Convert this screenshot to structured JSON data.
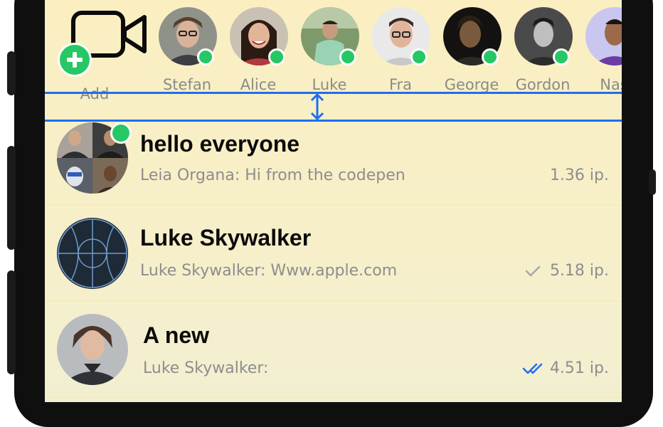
{
  "stories": {
    "add_label": "Add",
    "people": [
      {
        "name": "Stefan"
      },
      {
        "name": "Alice"
      },
      {
        "name": "Luke"
      },
      {
        "name": "Fra"
      },
      {
        "name": "George"
      },
      {
        "name": "Gordon"
      },
      {
        "name": "Nas"
      }
    ]
  },
  "chats": [
    {
      "title": "hello everyone",
      "preview": "Leia Organa: Hi from the codepen",
      "time": "1.36 ip.",
      "status": "none"
    },
    {
      "title": "Luke Skywalker",
      "preview": "Luke Skywalker: Www.apple.com",
      "time": "5.18 ip.",
      "status": "sent"
    },
    {
      "title": "A new",
      "preview": "Luke Skywalker:",
      "time": "4.51 ip.",
      "status": "read"
    }
  ],
  "colors": {
    "online": "#25c864",
    "guide": "#1d6ff2",
    "read_check": "#1d6ff2",
    "sent_check": "#a8a8a8"
  }
}
